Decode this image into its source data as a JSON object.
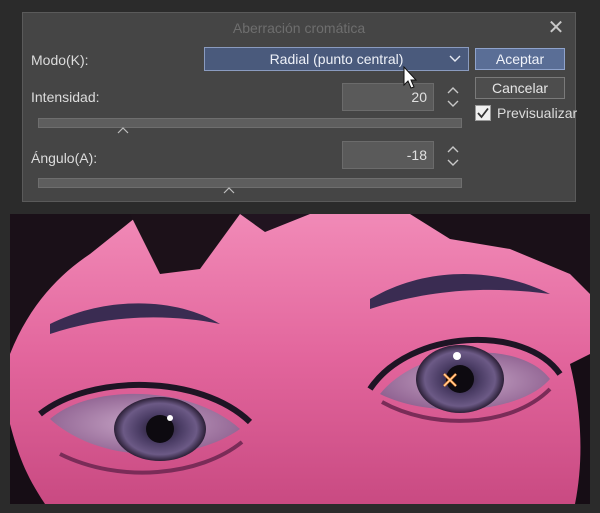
{
  "dialog": {
    "title": "Aberración cromática",
    "close_icon": "close-icon"
  },
  "mode": {
    "label": "Modo(K):",
    "selected": "Radial (punto central)"
  },
  "intensity": {
    "label": "Intensidad:",
    "value": "20",
    "slider_fraction": 0.2
  },
  "angle": {
    "label": "Ángulo(A):",
    "value": "-18",
    "slider_fraction": 0.45
  },
  "buttons": {
    "accept": "Aceptar",
    "cancel": "Cancelar"
  },
  "preview": {
    "label": "Previsualizar",
    "checked": true
  },
  "canvas": {
    "description_icon": "center-point-marker-icon"
  },
  "colors": {
    "accent": "#5a6e96",
    "dialog_bg": "#454545",
    "page_bg": "#2b2b2b"
  }
}
